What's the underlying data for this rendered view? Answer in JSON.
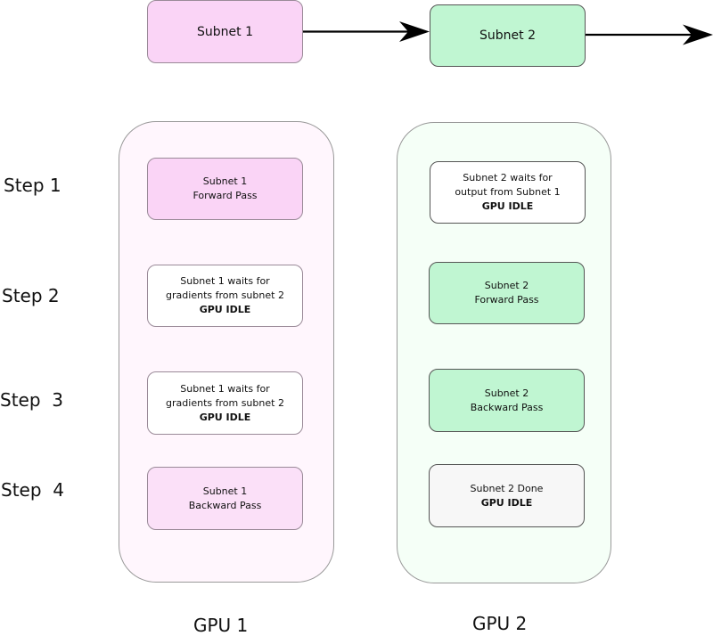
{
  "pipeline": {
    "subnet1": "Subnet 1",
    "subnet2": "Subnet 2"
  },
  "steps": [
    "Step 1",
    "Step 2",
    "Step  3",
    "Step  4"
  ],
  "gpu1": {
    "label": "GPU 1",
    "boxes": [
      {
        "line1": "Subnet 1",
        "line2": "Forward Pass",
        "line3": ""
      },
      {
        "line1": "Subnet 1 waits for",
        "line2": "gradients from subnet 2",
        "line3": "GPU IDLE"
      },
      {
        "line1": "Subnet 1 waits for",
        "line2": "gradients from subnet 2",
        "line3": "GPU IDLE"
      },
      {
        "line1": "Subnet 1",
        "line2": "Backward Pass",
        "line3": ""
      }
    ]
  },
  "gpu2": {
    "label": "GPU 2",
    "boxes": [
      {
        "line1": "Subnet 2 waits for",
        "line2": "output from  Subnet 1",
        "line3": "GPU IDLE"
      },
      {
        "line1": "Subnet 2",
        "line2": "Forward Pass",
        "line3": ""
      },
      {
        "line1": "Subnet 2",
        "line2": "Backward Pass",
        "line3": ""
      },
      {
        "line1": "Subnet 2 Done",
        "line2": "GPU IDLE",
        "line2_bold": true
      }
    ]
  },
  "colors": {
    "subnet1_fill": "#fad4f6",
    "subnet2_fill": "#c0f6d2",
    "gpu1_lane": "#fff6fd",
    "gpu2_lane": "#f5fff7",
    "done_fill": "#f7f7f7"
  }
}
